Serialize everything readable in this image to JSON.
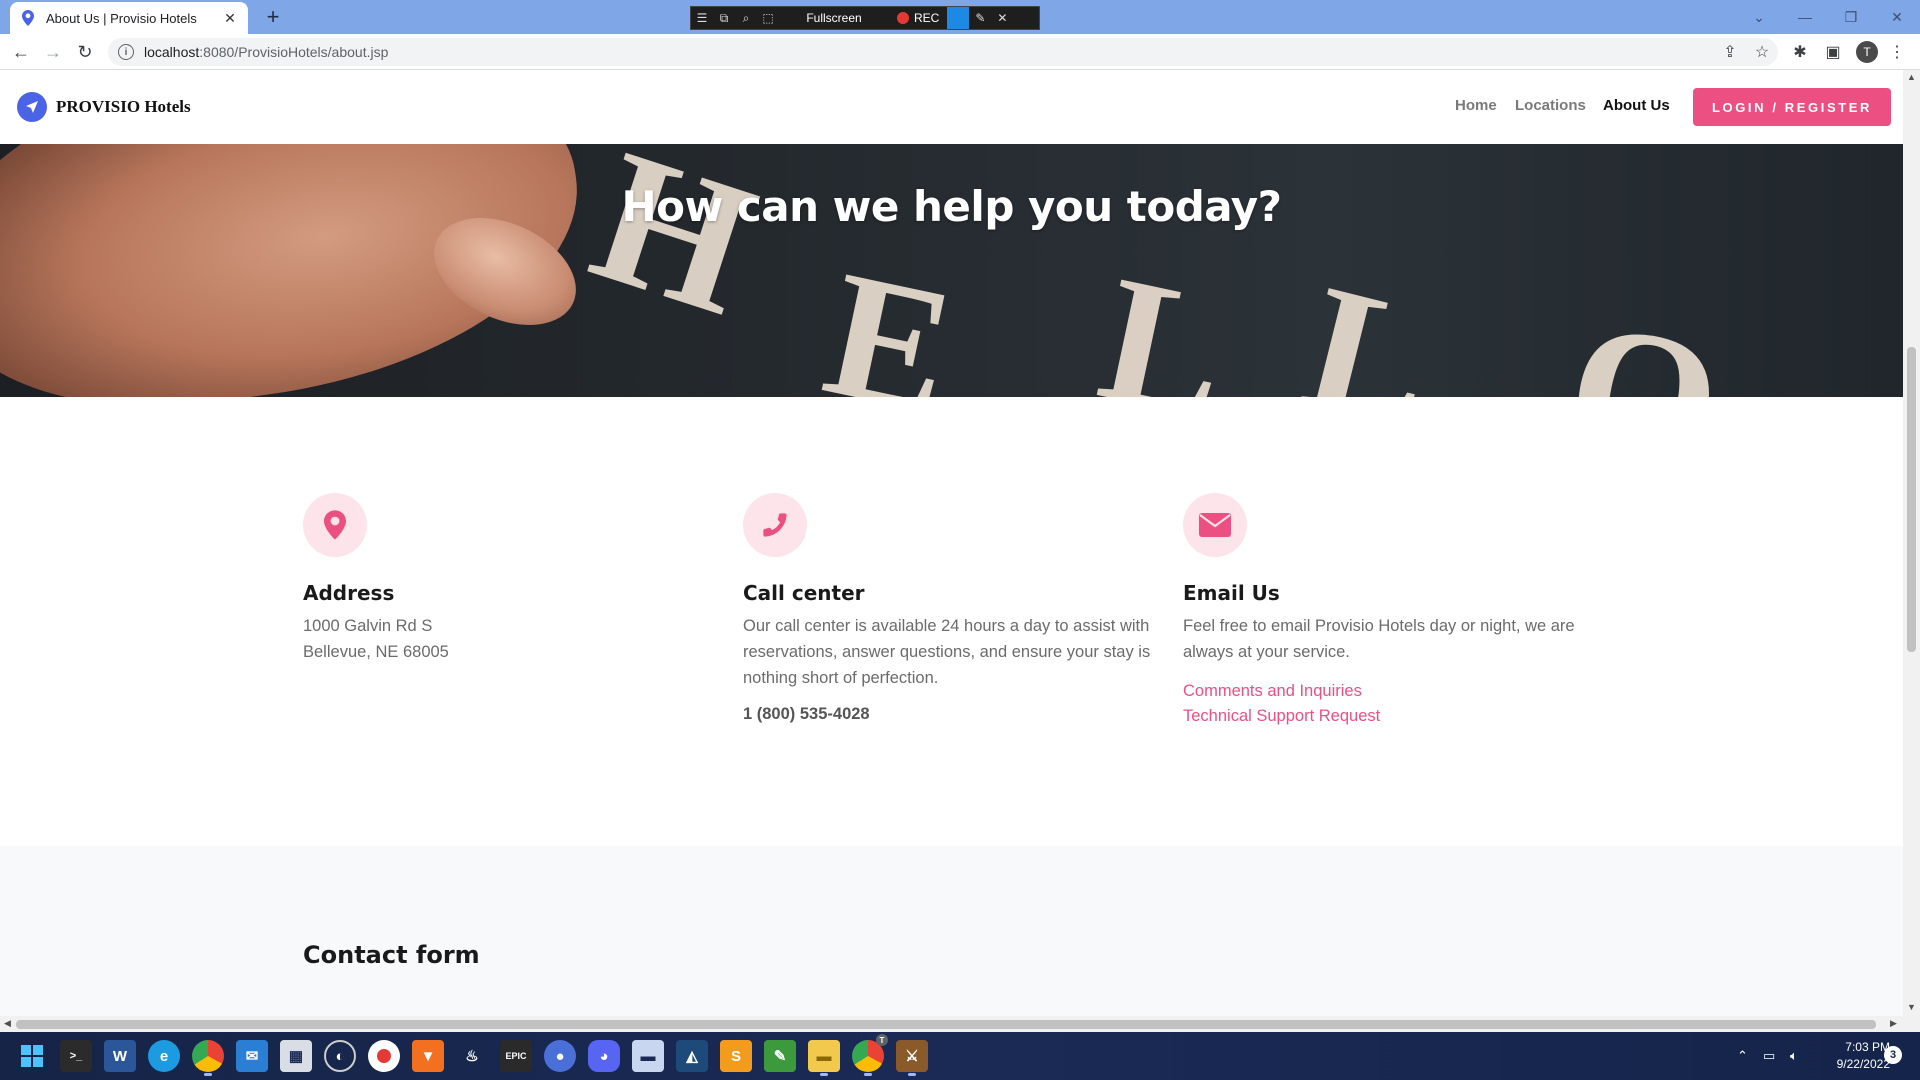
{
  "browser": {
    "tab_title": "About Us | Provisio Hotels",
    "tab_close": "✕",
    "new_tab": "+",
    "url_host": "localhost",
    "url_path": ":8080/ProvisioHotels/about.jsp",
    "avatar_initial": "T"
  },
  "recorder": {
    "fullscreen_label": "Fullscreen",
    "rec_label": "REC"
  },
  "site": {
    "brand": "PROVISIO Hotels",
    "nav": {
      "home": "Home",
      "locations": "Locations",
      "about": "About Us",
      "login": "LOGIN / REGISTER"
    },
    "hero": {
      "heading": "How can we help you today?",
      "letters": [
        "H",
        "E",
        "L",
        "L",
        "O"
      ]
    },
    "address": {
      "title": "Address",
      "line1": "1000 Galvin Rd S",
      "line2": "Bellevue, NE 68005"
    },
    "call_center": {
      "title": "Call center",
      "text": "Our call center is available 24 hours a day to assist with reservations, answer questions, and ensure your stay is nothing short of perfection.",
      "phone": "1 (800) 535-4028"
    },
    "email": {
      "title": "Email Us",
      "text": "Feel free to email Provisio Hotels day or night, we are always at your service.",
      "link1": "Comments and Inquiries",
      "link2": "Technical Support Request"
    },
    "contact_form": {
      "title": "Contact form"
    }
  },
  "taskbar": {
    "clock_time": "7:03 PM",
    "clock_date": "9/22/2022",
    "notification_count": "3",
    "chrome_badge": "T"
  },
  "colors": {
    "accent": "#ec4f81",
    "accent_light": "#fde3ea",
    "logo_blue": "#4b63e6",
    "tabbar": "#7fa6e6",
    "taskbar": "#1a2a55"
  }
}
